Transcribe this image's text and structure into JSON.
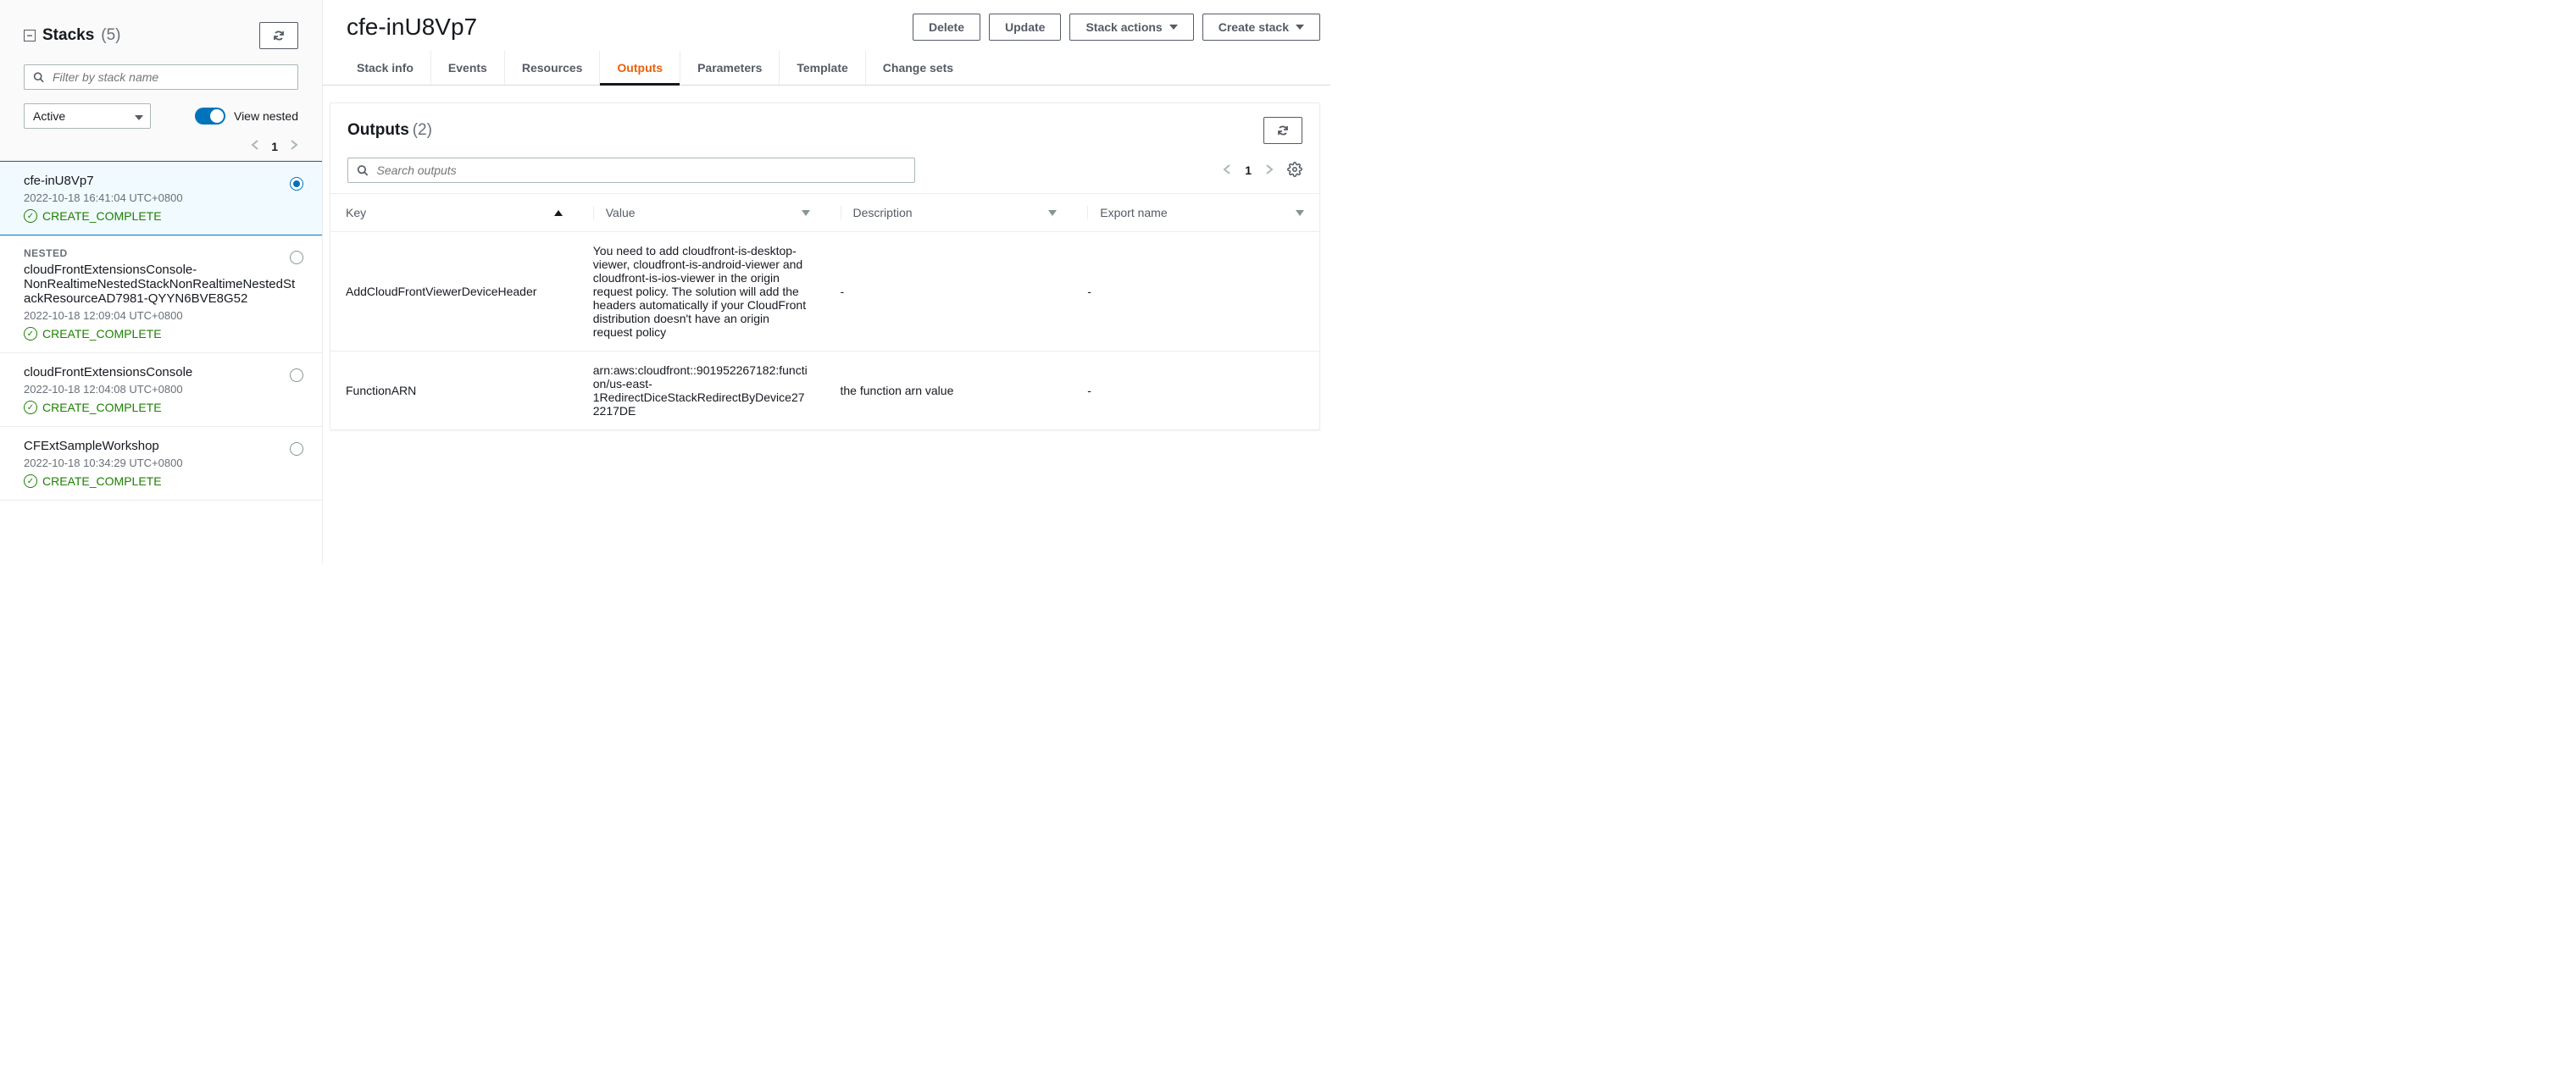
{
  "sidebar": {
    "title": "Stacks",
    "count": "(5)",
    "filter_placeholder": "Filter by stack name",
    "active_filter": "Active",
    "view_nested_label": "View nested",
    "page_number": "1",
    "items": [
      {
        "name": "cfe-inU8Vp7",
        "time": "2022-10-18 16:41:04 UTC+0800",
        "status": "CREATE_COMPLETE",
        "nested_label": null,
        "selected": true
      },
      {
        "name": "cloudFrontExtensionsConsole-NonRealtimeNestedStackNonRealtimeNestedStackResourceAD7981-QYYN6BVE8G52",
        "time": "2022-10-18 12:09:04 UTC+0800",
        "status": "CREATE_COMPLETE",
        "nested_label": "NESTED",
        "selected": false
      },
      {
        "name": "cloudFrontExtensionsConsole",
        "time": "2022-10-18 12:04:08 UTC+0800",
        "status": "CREATE_COMPLETE",
        "nested_label": null,
        "selected": false
      },
      {
        "name": "CFExtSampleWorkshop",
        "time": "2022-10-18 10:34:29 UTC+0800",
        "status": "CREATE_COMPLETE",
        "nested_label": null,
        "selected": false
      }
    ]
  },
  "header": {
    "title": "cfe-inU8Vp7",
    "buttons": {
      "delete": "Delete",
      "update": "Update",
      "stack_actions": "Stack actions",
      "create_stack": "Create stack"
    }
  },
  "tabs": [
    {
      "id": "stack-info",
      "label": "Stack info",
      "active": false
    },
    {
      "id": "events",
      "label": "Events",
      "active": false
    },
    {
      "id": "resources",
      "label": "Resources",
      "active": false
    },
    {
      "id": "outputs",
      "label": "Outputs",
      "active": true
    },
    {
      "id": "parameters",
      "label": "Parameters",
      "active": false
    },
    {
      "id": "template",
      "label": "Template",
      "active": false
    },
    {
      "id": "change-sets",
      "label": "Change sets",
      "active": false
    }
  ],
  "outputs_panel": {
    "title": "Outputs",
    "count": "(2)",
    "search_placeholder": "Search outputs",
    "page_number": "1",
    "columns": {
      "key": "Key",
      "value": "Value",
      "description": "Description",
      "export_name": "Export name"
    },
    "rows": [
      {
        "key": "AddCloudFrontViewerDeviceHeader",
        "value": "You need to add cloudfront-is-desktop-viewer, cloudfront-is-android-viewer and cloudfront-is-ios-viewer in the origin request policy. The solution will add the headers automatically if your CloudFront distribution doesn't have an origin request policy",
        "description": "-",
        "export_name": "-"
      },
      {
        "key": "FunctionARN",
        "value": "arn:aws:cloudfront::901952267182:function/us-east-1RedirectDiceStackRedirectByDevice272217DE",
        "description": "the function arn value",
        "export_name": "-"
      }
    ]
  }
}
